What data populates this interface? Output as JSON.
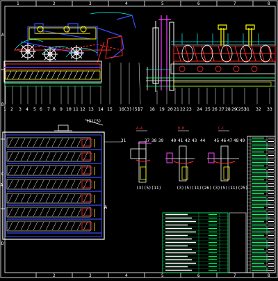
{
  "ruler_top": [
    "1",
    "2",
    "3",
    "4",
    "5",
    "6",
    "7",
    "8"
  ],
  "ruler_bottom": [
    "2",
    "3",
    "4",
    "5",
    "6",
    "7",
    "8"
  ],
  "ruler_left": [
    "A",
    "B",
    "C",
    "D"
  ],
  "callouts_front": [
    "1",
    "2",
    "3",
    "4",
    "5",
    "6",
    "7",
    "8",
    "9",
    "10",
    "11",
    "12",
    "13",
    "14",
    "15",
    "16",
    "17",
    "18"
  ],
  "callout_front_extra": "(3)(5)",
  "callouts_side": [
    "19",
    "20",
    "21",
    "22",
    "23",
    "24",
    "25",
    "26",
    "27",
    "28",
    "29",
    "30",
    "31",
    "32",
    "33"
  ],
  "callout_side_paren_25": "(25)",
  "callout_plan_top": "(3)(5)",
  "callout_plan_31": "31",
  "detail_callouts_a": [
    "37",
    "38",
    "39"
  ],
  "detail_callouts_b": [
    "40",
    "41",
    "42",
    "43",
    "44"
  ],
  "detail_callouts_c": [
    "45",
    "46",
    "47",
    "48",
    "49"
  ],
  "detail_labels": [
    "(3)(5)(11)",
    "(3)(5)(11)(26)",
    "(3)(5)(11)(25)"
  ],
  "detail_title_a": "A-A",
  "detail_title_b": "B-B",
  "detail_title_c": "C-C",
  "plan_left_mark": "A",
  "plan_right_mark": "A",
  "colors": {
    "bg": "#000000",
    "frame": "#ffffff",
    "blue": "#3a4cff",
    "cyan": "#00e0e0",
    "red": "#ff2a2a",
    "yellow": "#ffff00",
    "green": "#00ff66",
    "magenta": "#ff40ff",
    "white": "#ffffff"
  }
}
